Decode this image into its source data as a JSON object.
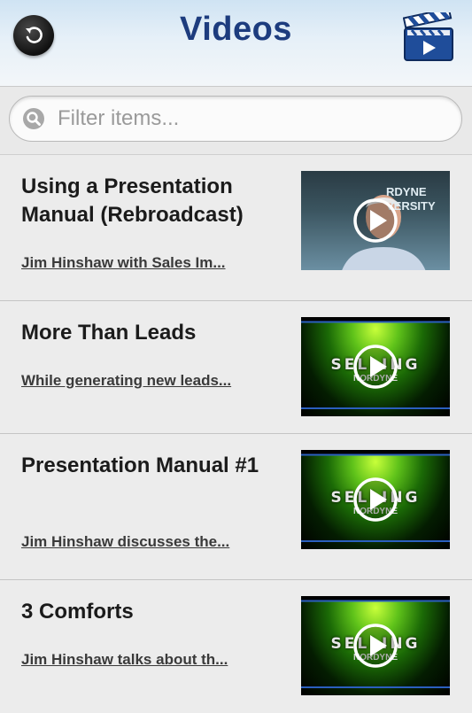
{
  "header": {
    "title": "Videos",
    "back_icon": "back-arrow-icon",
    "action_icon": "video-clapper-icon"
  },
  "search": {
    "placeholder": "Filter items...",
    "value": ""
  },
  "items": [
    {
      "title": "Using a Presentation Manual (Rebroadcast)",
      "subtitle": "Jim Hinshaw with Sales Im...",
      "thumb": "presenter-video-thumbnail",
      "thumb_text": "RDYNE\nVERSITY"
    },
    {
      "title": "More Than Leads",
      "subtitle": "While generating new leads...",
      "thumb": "selling-nordyne-video-thumbnail",
      "thumb_text": "SELLING",
      "thumb_sub": "NORDYNE"
    },
    {
      "title": "Presentation Manual #1",
      "subtitle": "Jim Hinshaw discusses the...",
      "thumb": "selling-nordyne-video-thumbnail",
      "thumb_text": "SELLING",
      "thumb_sub": "NORDYNE"
    },
    {
      "title": "3 Comforts",
      "subtitle": "Jim Hinshaw talks about th...",
      "thumb": "selling-nordyne-video-thumbnail",
      "thumb_text": "SELLING",
      "thumb_sub": "NORDYNE"
    }
  ],
  "colors": {
    "title": "#1d3c7e",
    "background": "#ececec",
    "thumb_green": "#5fc21a",
    "thumb_blue_line": "#2b5fbf"
  }
}
